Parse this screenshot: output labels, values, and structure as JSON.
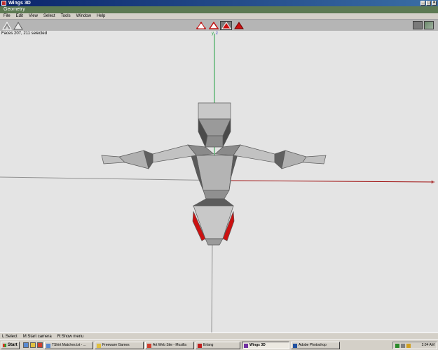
{
  "window": {
    "title": "Wings 3D",
    "minimize_glyph": "_",
    "maximize_glyph": "□",
    "close_glyph": "×"
  },
  "panel": {
    "header": "Geometry"
  },
  "menu": {
    "items": [
      "File",
      "Edit",
      "View",
      "Select",
      "Tools",
      "Window",
      "Help"
    ]
  },
  "viewport": {
    "status": "Faces 207, 211 selected",
    "axis_labels": {
      "y": "y",
      "z": "z",
      "x": "x"
    },
    "colors": {
      "background": "#e4e4e4",
      "mesh": "#b4b4b4",
      "selected": "#cc1111",
      "x_axis": "#a01010",
      "y_axis": "#20a040",
      "z_axis": "#3030c0"
    }
  },
  "infobar": {
    "items": [
      "L:Select",
      "M:Start camera",
      "R:Show menu"
    ]
  },
  "taskbar": {
    "start_label": "Start",
    "tasks": [
      {
        "label": "TShirt Matches.txt - ...",
        "icon": "notepad-icon",
        "active": false
      },
      {
        "label": "Freeware Games",
        "icon": "folder-icon",
        "active": false
      },
      {
        "label": "Art Web Site - Mozilla",
        "icon": "mozilla-icon",
        "active": false
      },
      {
        "label": "Erlang",
        "icon": "erlang-icon",
        "active": false
      },
      {
        "label": "Wings 3D",
        "icon": "wings-icon",
        "active": true
      },
      {
        "label": "Adobe Photoshop",
        "icon": "photoshop-icon",
        "active": false
      }
    ],
    "clock": "2:04 AM"
  }
}
